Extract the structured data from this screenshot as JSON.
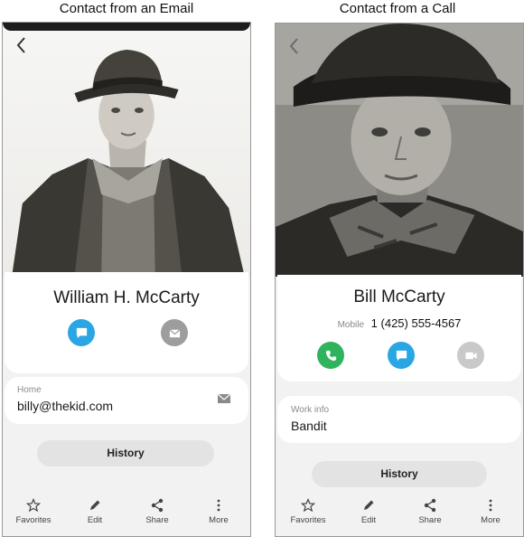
{
  "captions": {
    "left": "Contact from an Email",
    "right": "Contact from a Call"
  },
  "email_contact": {
    "name": "William H. McCarty",
    "actions": [
      "message",
      "email"
    ],
    "field": {
      "label": "Home",
      "value": "billy@thekid.com"
    },
    "history_label": "History"
  },
  "call_contact": {
    "name": "Bill McCarty",
    "phone_label": "Mobile",
    "phone_number": "1 (425) 555-4567",
    "actions": [
      "call",
      "message",
      "video"
    ],
    "field": {
      "label": "Work info",
      "value": "Bandit"
    },
    "history_label": "History"
  },
  "bottom_nav": [
    "Favorites",
    "Edit",
    "Share",
    "More"
  ],
  "icons": {
    "back": "chevron-left-icon",
    "message": "chat-bubble-icon",
    "email": "envelope-icon",
    "call": "phone-icon",
    "video": "video-camera-icon",
    "favorites": "star-outline-icon",
    "edit": "pencil-icon",
    "share": "share-icon",
    "more": "vertical-dots-icon"
  },
  "colors": {
    "message_button": "#2aa6e3",
    "email_button": "#9d9d9d",
    "call_button": "#2fb35d",
    "video_button": "#c9c9c9",
    "background": "#f2f2f2"
  }
}
